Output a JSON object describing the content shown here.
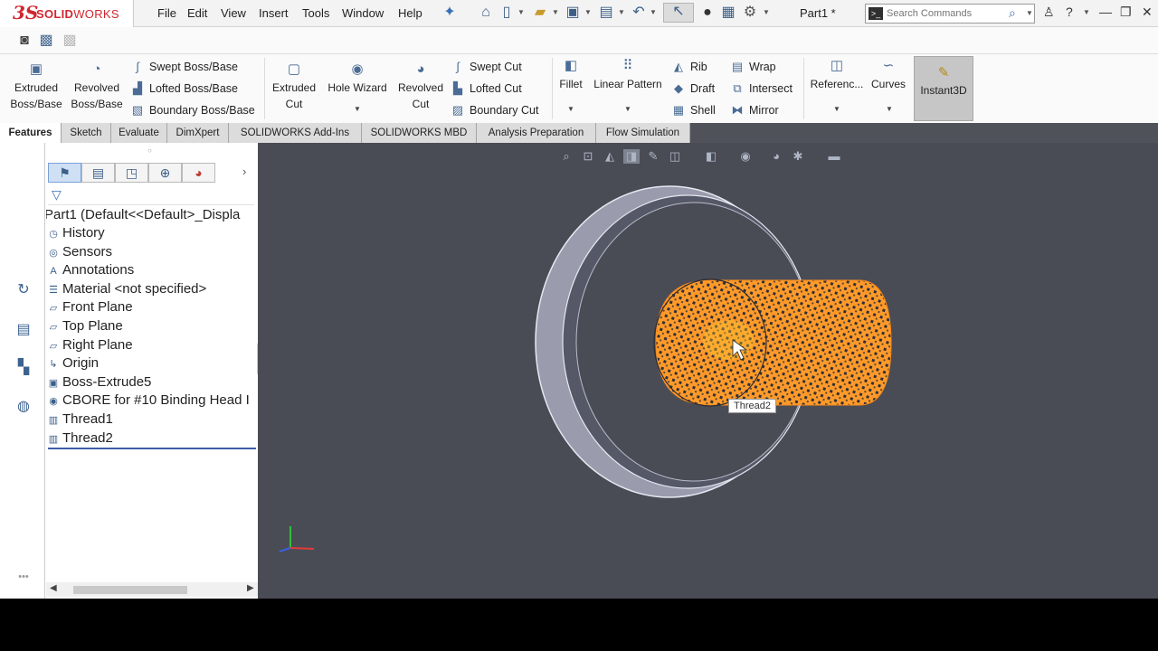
{
  "app": {
    "brand_ds": "3S",
    "brand_solid": "SOLID",
    "brand_works": "WORKS",
    "document_title": "Part1 *"
  },
  "menu": [
    "File",
    "Edit",
    "View",
    "Insert",
    "Tools",
    "Window",
    "Help"
  ],
  "search": {
    "placeholder": "Search Commands"
  },
  "command_manager": {
    "extruded_boss": "Extruded Boss/Base",
    "revolved_boss": "Revolved Boss/Base",
    "swept_boss": "Swept Boss/Base",
    "lofted_boss": "Lofted Boss/Base",
    "boundary_boss": "Boundary Boss/Base",
    "extruded_cut": "Extruded Cut",
    "hole_wizard": "Hole Wizard",
    "revolved_cut": "Revolved Cut",
    "swept_cut": "Swept Cut",
    "lofted_cut": "Lofted Cut",
    "boundary_cut": "Boundary Cut",
    "fillet": "Fillet",
    "linear_pattern": "Linear Pattern",
    "rib": "Rib",
    "draft": "Draft",
    "shell": "Shell",
    "wrap": "Wrap",
    "intersect": "Intersect",
    "mirror": "Mirror",
    "reference": "Referenc...",
    "curves": "Curves",
    "instant3d": "Instant3D"
  },
  "tabs": [
    "Features",
    "Sketch",
    "Evaluate",
    "DimXpert",
    "SOLIDWORKS Add-Ins",
    "SOLIDWORKS MBD",
    "Analysis Preparation",
    "Flow Simulation"
  ],
  "active_tab": "Features",
  "tree": {
    "root": "Part1  (Default<<Default>_Displa",
    "items": [
      {
        "label": "History",
        "icon": "history-icon"
      },
      {
        "label": "Sensors",
        "icon": "sensors-icon"
      },
      {
        "label": "Annotations",
        "icon": "annotations-icon"
      },
      {
        "label": "Material <not specified>",
        "icon": "material-icon"
      },
      {
        "label": "Front Plane",
        "icon": "plane-icon"
      },
      {
        "label": "Top Plane",
        "icon": "plane-icon"
      },
      {
        "label": "Right Plane",
        "icon": "plane-icon"
      },
      {
        "label": "Origin",
        "icon": "origin-icon"
      },
      {
        "label": "Boss-Extrude5",
        "icon": "extrude-icon"
      },
      {
        "label": "CBORE for #10 Binding Head I",
        "icon": "hole-icon"
      },
      {
        "label": "Thread1",
        "icon": "thread-icon"
      },
      {
        "label": "Thread2",
        "icon": "thread-icon"
      }
    ]
  },
  "viewport": {
    "tooltip": "Thread2",
    "thread_color": "#ff8c1a",
    "part_color": "#9a9cad",
    "background": "#4a4c55"
  }
}
